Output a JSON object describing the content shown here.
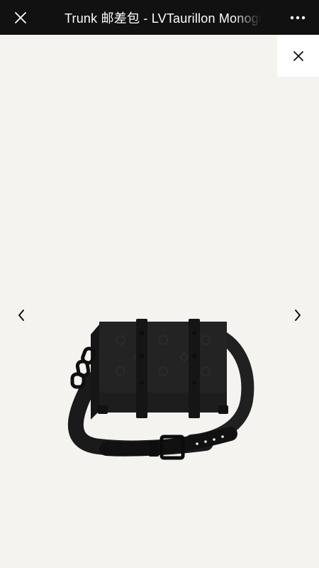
{
  "header": {
    "title": "Trunk 邮差包 - LVTaurillon Monogram",
    "close_icon": "close-icon",
    "more_icon": "more-icon"
  },
  "viewer": {
    "close_icon": "close-icon",
    "prev_icon": "chevron-left-icon",
    "next_icon": "chevron-right-icon",
    "image_subject": "black monogram trunk messenger bag"
  },
  "colors": {
    "topbar_bg": "#111111",
    "page_bg": "#f5f3f0",
    "bag": "#1c1c1c"
  }
}
